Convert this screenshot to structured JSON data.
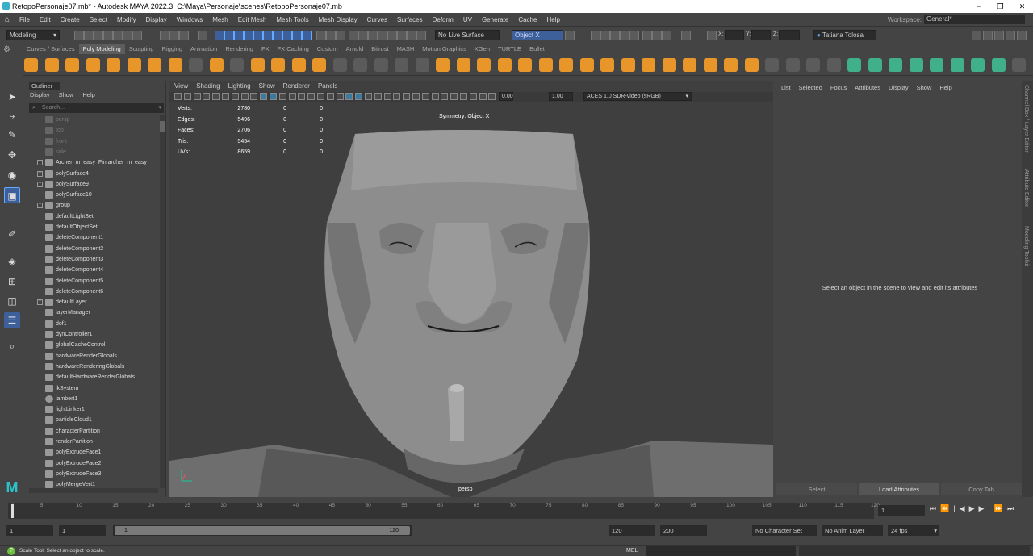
{
  "window": {
    "title": "RetopoPersonaje07.mb* - Autodesk MAYA 2022.3: C:\\Maya\\Personaje\\scenes\\RetopoPersonaje07.mb",
    "min": "−",
    "max": "❐",
    "close": "✕"
  },
  "menus": [
    "File",
    "Edit",
    "Create",
    "Select",
    "Modify",
    "Display",
    "Windows",
    "Mesh",
    "Edit Mesh",
    "Mesh Tools",
    "Mesh Display",
    "Curves",
    "Surfaces",
    "Deform",
    "UV",
    "Generate",
    "Cache",
    "Help"
  ],
  "workspace": {
    "label": "Workspace:",
    "value": "General*"
  },
  "statusline": {
    "menuset": "Modeling",
    "live_surface": "No Live Surface",
    "symmetry": "Object X",
    "x_label": "X:",
    "y_label": "Y:",
    "z_label": "Z:",
    "user": "Tatiana Tolosa"
  },
  "shelf_tabs": [
    "Curves / Surfaces",
    "Poly Modeling",
    "Sculpting",
    "Rigging",
    "Animation",
    "Rendering",
    "FX",
    "FX Caching",
    "Custom",
    "Arnold",
    "Bifrost",
    "MASH",
    "Motion Graphics",
    "XGen",
    "TURTLE",
    "Bullet"
  ],
  "shelf_active": "Poly Modeling",
  "outliner": {
    "tab": "Outliner",
    "menu": [
      "Display",
      "Show",
      "Help"
    ],
    "search_placeholder": "Search...",
    "items": [
      {
        "label": "persp",
        "dim": true,
        "expand": false
      },
      {
        "label": "top",
        "dim": true,
        "expand": false
      },
      {
        "label": "front",
        "dim": true,
        "expand": false
      },
      {
        "label": "side",
        "dim": true,
        "expand": false
      },
      {
        "label": "Archer_m_easy_Fin:archer_m_easy",
        "dim": false,
        "expand": true
      },
      {
        "label": "polySurface4",
        "dim": false,
        "expand": true
      },
      {
        "label": "polySurface9",
        "dim": false,
        "expand": true
      },
      {
        "label": "polySurface10",
        "dim": false,
        "expand": false
      },
      {
        "label": "group",
        "dim": false,
        "expand": true
      },
      {
        "label": "defaultLightSet",
        "dim": false,
        "expand": false
      },
      {
        "label": "defaultObjectSet",
        "dim": false,
        "expand": false
      },
      {
        "label": "deleteComponent1",
        "dim": false,
        "expand": false
      },
      {
        "label": "deleteComponent2",
        "dim": false,
        "expand": false
      },
      {
        "label": "deleteComponent3",
        "dim": false,
        "expand": false
      },
      {
        "label": "deleteComponent4",
        "dim": false,
        "expand": false
      },
      {
        "label": "deleteComponent5",
        "dim": false,
        "expand": false
      },
      {
        "label": "deleteComponent6",
        "dim": false,
        "expand": false
      },
      {
        "label": "defaultLayer",
        "dim": false,
        "expand": true
      },
      {
        "label": "layerManager",
        "dim": false,
        "expand": false
      },
      {
        "label": "dof1",
        "dim": false,
        "expand": false
      },
      {
        "label": "dynController1",
        "dim": false,
        "expand": false
      },
      {
        "label": "globalCacheControl",
        "dim": false,
        "expand": false
      },
      {
        "label": "hardwareRenderGlobals",
        "dim": false,
        "expand": false
      },
      {
        "label": "hardwareRenderingGlobals",
        "dim": false,
        "expand": false
      },
      {
        "label": "defaultHardwareRenderGlobals",
        "dim": false,
        "expand": false
      },
      {
        "label": "ikSystem",
        "dim": false,
        "expand": false
      },
      {
        "label": "lambert1",
        "dim": false,
        "expand": false
      },
      {
        "label": "lightLinker1",
        "dim": false,
        "expand": false
      },
      {
        "label": "particleCloud1",
        "dim": false,
        "expand": false
      },
      {
        "label": "characterPartition",
        "dim": false,
        "expand": false
      },
      {
        "label": "renderPartition",
        "dim": false,
        "expand": false
      },
      {
        "label": "polyExtrudeFace1",
        "dim": false,
        "expand": false
      },
      {
        "label": "polyExtrudeFace2",
        "dim": false,
        "expand": false
      },
      {
        "label": "polyExtrudeFace3",
        "dim": false,
        "expand": false
      },
      {
        "label": "polyMergeVert1",
        "dim": false,
        "expand": false
      }
    ]
  },
  "viewport": {
    "menu": [
      "View",
      "Shading",
      "Lighting",
      "Show",
      "Renderer",
      "Panels"
    ],
    "exposure": "0.00",
    "gamma": "1.00",
    "colorspace": "ACES 1.0 SDR-video (sRGB)",
    "hud": [
      {
        "label": "Verts:",
        "a": "2780",
        "b": "0",
        "c": "0"
      },
      {
        "label": "Edges:",
        "a": "5496",
        "b": "0",
        "c": "0"
      },
      {
        "label": "Faces:",
        "a": "2706",
        "b": "0",
        "c": "0"
      },
      {
        "label": "Tris:",
        "a": "5454",
        "b": "0",
        "c": "0"
      },
      {
        "label": "UVs:",
        "a": "8659",
        "b": "0",
        "c": "0"
      }
    ],
    "symmetry": "Symmetry: Object X",
    "camera": "persp"
  },
  "attribute_editor": {
    "menu": [
      "List",
      "Selected",
      "Focus",
      "Attributes",
      "Display",
      "Show",
      "Help"
    ],
    "message": "Select an object in the scene to view and edit its attributes",
    "buttons": [
      "Select",
      "Load Attributes",
      "Copy Tab"
    ]
  },
  "side_tabs": [
    "Channel Box / Layer Editor",
    "Attribute Editor",
    "Modeling Toolkit"
  ],
  "timeslider": {
    "ticks": [
      "1",
      "5",
      "10",
      "15",
      "20",
      "25",
      "30",
      "35",
      "40",
      "45",
      "50",
      "55",
      "60",
      "65",
      "70",
      "75",
      "80",
      "85",
      "90",
      "95",
      "100",
      "105",
      "110",
      "115",
      "120"
    ],
    "current": "1"
  },
  "range": {
    "start": "1",
    "inner_start": "1",
    "slider_start": "1",
    "slider_end": "120",
    "end": "120",
    "anim_end": "200",
    "character_set": "No Character Set",
    "anim_layer": "No Anim Layer",
    "fps": "24 fps"
  },
  "helpline": {
    "text": "Scale Tool: Select an object to scale.",
    "mel": "MEL"
  }
}
